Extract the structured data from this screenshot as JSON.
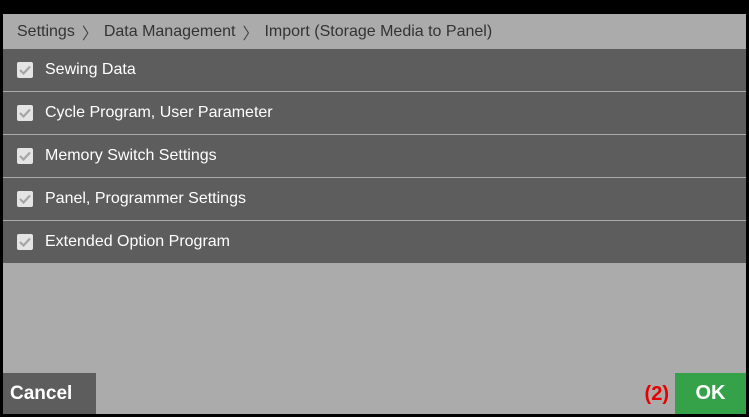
{
  "breadcrumb": {
    "items": [
      "Settings",
      "Data Management",
      "Import (Storage Media to Panel)"
    ],
    "separator": "〉"
  },
  "options": [
    {
      "label": "Sewing Data",
      "checked": true
    },
    {
      "label": "Cycle Program, User Parameter",
      "checked": true
    },
    {
      "label": "Memory Switch Settings",
      "checked": true
    },
    {
      "label": "Panel, Programmer Settings",
      "checked": true
    },
    {
      "label": "Extended Option Program",
      "checked": true
    }
  ],
  "footer": {
    "cancel_label": "Cancel",
    "step_annotation": "(2)",
    "ok_label": "OK"
  },
  "colors": {
    "frame": "#000000",
    "background": "#ababab",
    "row_background": "#5d5d5d",
    "checkmark": "#a5a5a5",
    "ok_green": "#35a24a",
    "annotation_red": "#e60000"
  },
  "icons": {
    "checkbox": "checkbox-checked-icon"
  }
}
